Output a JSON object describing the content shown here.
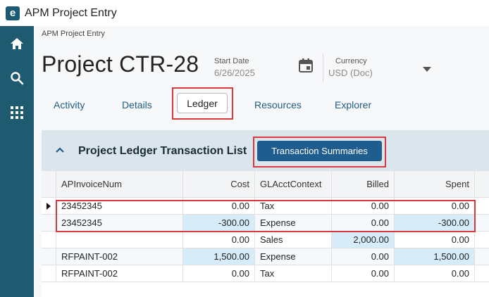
{
  "window": {
    "title": "APM Project Entry",
    "logo_letter": "e"
  },
  "sidebar": {
    "items": [
      "home-icon",
      "search-icon",
      "apps-grid-icon"
    ]
  },
  "breadcrumb": "APM Project Entry",
  "project": {
    "title": "Project CTR-28"
  },
  "start_date": {
    "label": "Start Date",
    "value": "6/26/2025"
  },
  "currency": {
    "label": "Currency",
    "value": "USD (Doc)"
  },
  "tabs": [
    {
      "label": "Activity"
    },
    {
      "label": "Details"
    },
    {
      "label": "Ledger"
    },
    {
      "label": "Resources"
    },
    {
      "label": "Explorer"
    }
  ],
  "panel": {
    "title": "Project Ledger Transaction List",
    "summary_button": "Transaction Summaries"
  },
  "grid": {
    "columns": [
      "APInvoiceNum",
      "Cost",
      "GLAcctContext",
      "Billed",
      "Spent"
    ],
    "rows": [
      [
        "23452345",
        "0.00",
        "Tax",
        "0.00",
        "0.00"
      ],
      [
        "23452345",
        "-300.00",
        "Expense",
        "0.00",
        "-300.00"
      ],
      [
        "",
        "0.00",
        "Sales",
        "2,000.00",
        "0.00"
      ],
      [
        "RFPAINT-002",
        "1,500.00",
        "Expense",
        "0.00",
        "1,500.00"
      ],
      [
        "RFPAINT-002",
        "0.00",
        "Tax",
        "0.00",
        "0.00"
      ]
    ]
  },
  "colors": {
    "sidebar": "#1e5a70",
    "accent_button": "#1f5d8e",
    "highlight": "#d9393e",
    "panel_header": "#dbe6ec",
    "modified_cell": "#d6ecf8"
  }
}
